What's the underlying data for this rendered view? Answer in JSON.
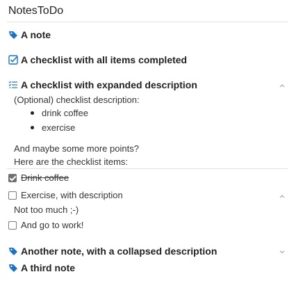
{
  "app": {
    "title": "NotesToDo"
  },
  "colors": {
    "accent": "#1a73c7",
    "text": "#222222",
    "muted": "#9aa5b1"
  },
  "entries": [
    {
      "type": "note",
      "label": "A note",
      "icon": "tag-icon"
    },
    {
      "type": "checklist-completed",
      "label": "A checklist with all items completed",
      "icon": "checkbox-checked-icon"
    },
    {
      "type": "checklist-expanded",
      "label": "A checklist with expanded description",
      "icon": "list-icon",
      "description_intro": "(Optional) checklist description:",
      "bullets": [
        "drink coffee",
        "exercise"
      ],
      "description_more": "And maybe some more points?",
      "description_items_intro": "Here are the checklist items:",
      "items": [
        {
          "label": "Drink coffee",
          "checked": true
        },
        {
          "label": "Exercise, with description",
          "checked": false,
          "description": "Not too much ;-)"
        },
        {
          "label": "And go to work!",
          "checked": false
        }
      ]
    },
    {
      "type": "note",
      "label": "Another note, with a collapsed description",
      "icon": "tag-icon"
    },
    {
      "type": "note",
      "label": "A third note",
      "icon": "tag-icon"
    }
  ]
}
